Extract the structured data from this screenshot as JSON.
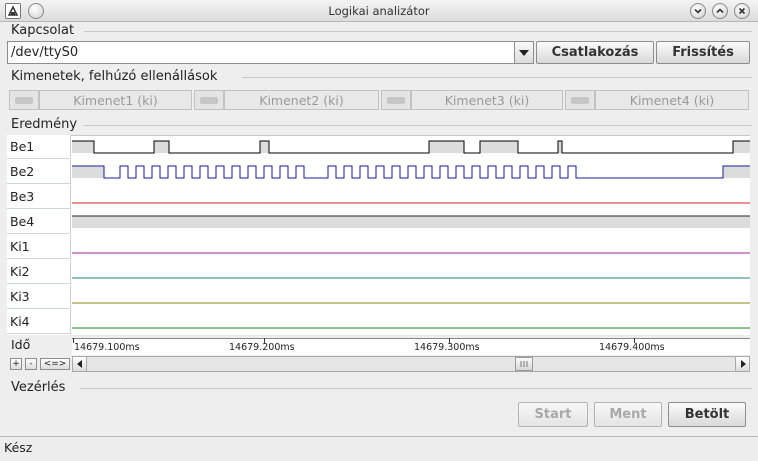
{
  "window": {
    "title": "Logikai analizátor"
  },
  "connection": {
    "section_label": "Kapcsolat",
    "port_value": "/dev/ttyS0",
    "connect_label": "Csatlakozás",
    "refresh_label": "Frissítés"
  },
  "outputs": {
    "section_label": "Kimenetek, felhúzó ellenállások",
    "items": [
      {
        "label": "Kimenet1 (ki)"
      },
      {
        "label": "Kimenet2 (ki)"
      },
      {
        "label": "Kimenet3 (ki)"
      },
      {
        "label": "Kimenet4 (ki)"
      }
    ]
  },
  "result": {
    "section_label": "Eredmény",
    "channels": [
      {
        "name": "Be1",
        "color": "#000000"
      },
      {
        "name": "Be2",
        "color": "#1a1aa0"
      },
      {
        "name": "Be3",
        "color": "#d42020"
      },
      {
        "name": "Be4",
        "color": "#222222"
      },
      {
        "name": "Ki1",
        "color": "#a020a0"
      },
      {
        "name": "Ki2",
        "color": "#208080"
      },
      {
        "name": "Ki3",
        "color": "#8a8a10"
      },
      {
        "name": "Ki4",
        "color": "#208020"
      }
    ],
    "time_label": "Idő",
    "time_ticks": [
      "14679.100ms",
      "14679.200ms",
      "14679.300ms",
      "14679.400ms"
    ],
    "zoom_in": "+",
    "zoom_out": "-",
    "zoom_fit": "<=>"
  },
  "control": {
    "section_label": "Vezérlés",
    "start_label": "Start",
    "save_label": "Ment",
    "load_label": "Betölt"
  },
  "status": {
    "text": "Kész"
  }
}
